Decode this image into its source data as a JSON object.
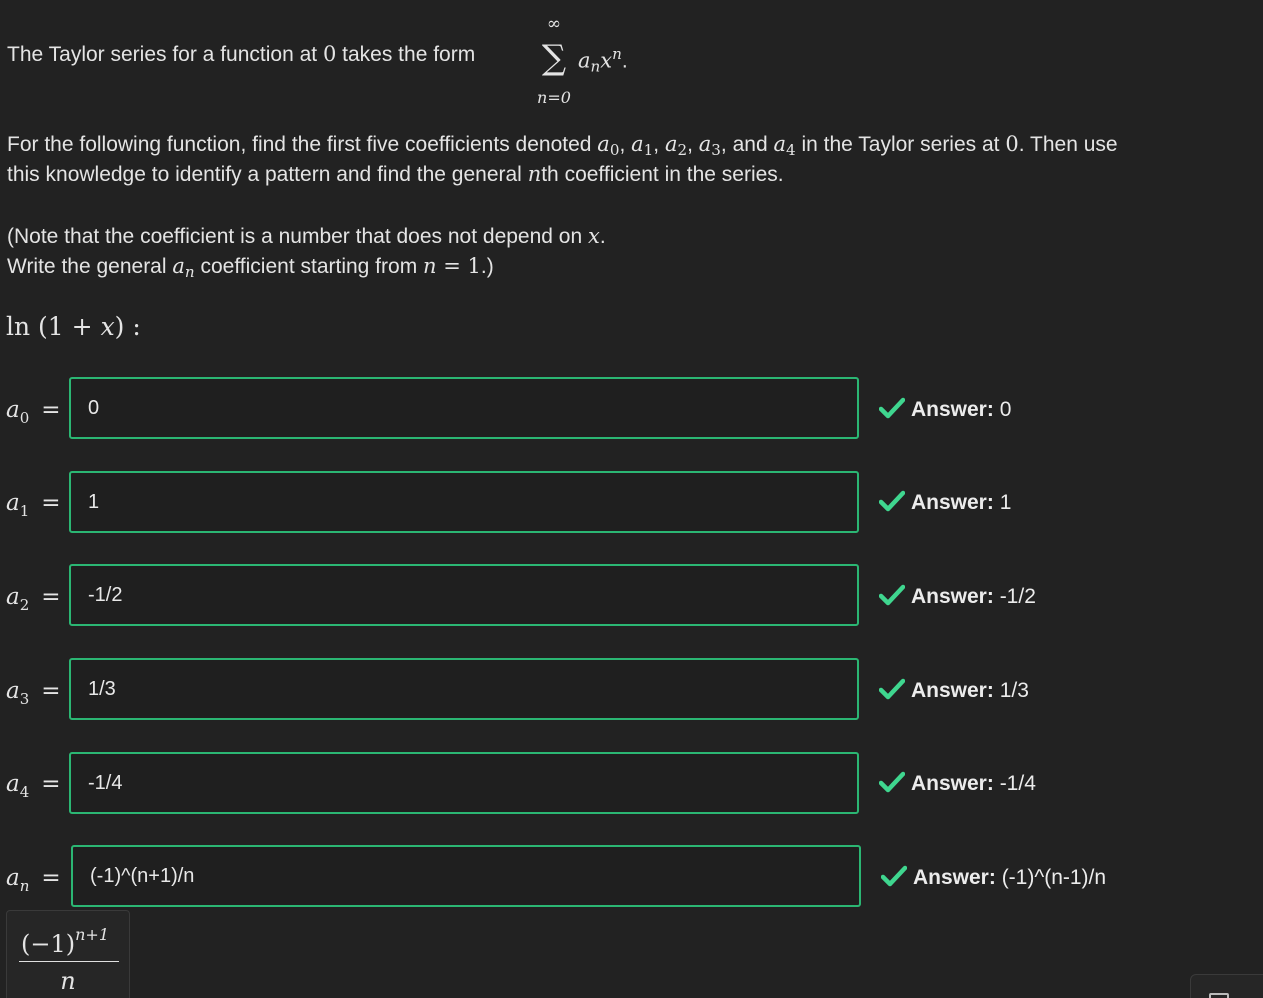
{
  "intro": {
    "before": "The Taylor series for a function at ",
    "zero": "0",
    "after": " takes the form ",
    "sum_upper": "∞",
    "sum_symbol": "∑",
    "sum_lower": "n=0",
    "term_a": "a",
    "term_a_sub": "n",
    "term_x": "x",
    "term_x_sup": "n",
    "period": "."
  },
  "instructions": {
    "l1_a": "For the following function, find the first five coefficients denoted ",
    "l1_b": ", and ",
    "l1_c": " in the Taylor series at ",
    "l1_zero": "0",
    "l1_d": ". Then use",
    "line2_a": "this knowledge to identify a pattern and find the general ",
    "line2_n": "n",
    "line2_b": "th coefficient in the series."
  },
  "note": {
    "line1_a": "(Note that the coefficient is a number that does not depend on ",
    "line1_x": "x",
    "line1_b": ".",
    "line2_a": "Write the general ",
    "line2_a_var": "a",
    "line2_a_sub": "n",
    "line2_b": " coefficient starting from ",
    "line2_n": "n",
    "line2_eq": " = 1",
    "line2_c": ".)"
  },
  "function_label": {
    "ln": "ln",
    "open": " (1 + ",
    "x": "x",
    "close": ") :"
  },
  "rows": [
    {
      "var": "a",
      "sub": "0",
      "eq": "=",
      "value": "0",
      "answer_label": "Answer:",
      "answer_value": " 0"
    },
    {
      "var": "a",
      "sub": "1",
      "eq": "=",
      "value": "1",
      "answer_label": "Answer:",
      "answer_value": " 1"
    },
    {
      "var": "a",
      "sub": "2",
      "eq": "=",
      "value": "-1/2",
      "answer_label": "Answer:",
      "answer_value": " -1/2"
    },
    {
      "var": "a",
      "sub": "3",
      "eq": "=",
      "value": "1/3",
      "answer_label": "Answer:",
      "answer_value": " 1/3"
    },
    {
      "var": "a",
      "sub": "4",
      "eq": "=",
      "value": "-1/4",
      "answer_label": "Answer:",
      "answer_value": " -1/4"
    },
    {
      "var": "a",
      "sub": "n",
      "eq": "=",
      "value": "(-1)^(n+1)/n",
      "answer_label": "Answer:",
      "answer_value": " (-1)^(n-1)/n"
    }
  ],
  "preview": {
    "numerator": "(−1)",
    "exponent": "n+1",
    "denominator": "n"
  },
  "colors": {
    "background": "#222222",
    "field_border": "#2bb673",
    "check": "#3fd68f"
  }
}
